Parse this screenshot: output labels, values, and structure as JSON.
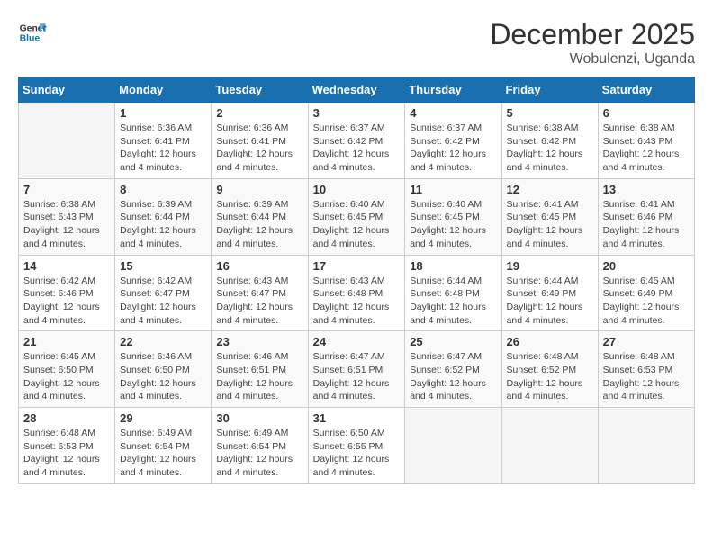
{
  "logo": {
    "line1": "General",
    "line2": "Blue"
  },
  "title": "December 2025",
  "subtitle": "Wobulenzi, Uganda",
  "days_of_week": [
    "Sunday",
    "Monday",
    "Tuesday",
    "Wednesday",
    "Thursday",
    "Friday",
    "Saturday"
  ],
  "weeks": [
    [
      {
        "day": "",
        "info": ""
      },
      {
        "day": "1",
        "info": "Sunrise: 6:36 AM\nSunset: 6:41 PM\nDaylight: 12 hours and 4 minutes."
      },
      {
        "day": "2",
        "info": "Sunrise: 6:36 AM\nSunset: 6:41 PM\nDaylight: 12 hours and 4 minutes."
      },
      {
        "day": "3",
        "info": "Sunrise: 6:37 AM\nSunset: 6:42 PM\nDaylight: 12 hours and 4 minutes."
      },
      {
        "day": "4",
        "info": "Sunrise: 6:37 AM\nSunset: 6:42 PM\nDaylight: 12 hours and 4 minutes."
      },
      {
        "day": "5",
        "info": "Sunrise: 6:38 AM\nSunset: 6:42 PM\nDaylight: 12 hours and 4 minutes."
      },
      {
        "day": "6",
        "info": "Sunrise: 6:38 AM\nSunset: 6:43 PM\nDaylight: 12 hours and 4 minutes."
      }
    ],
    [
      {
        "day": "7",
        "info": "Sunrise: 6:38 AM\nSunset: 6:43 PM\nDaylight: 12 hours and 4 minutes."
      },
      {
        "day": "8",
        "info": "Sunrise: 6:39 AM\nSunset: 6:44 PM\nDaylight: 12 hours and 4 minutes."
      },
      {
        "day": "9",
        "info": "Sunrise: 6:39 AM\nSunset: 6:44 PM\nDaylight: 12 hours and 4 minutes."
      },
      {
        "day": "10",
        "info": "Sunrise: 6:40 AM\nSunset: 6:45 PM\nDaylight: 12 hours and 4 minutes."
      },
      {
        "day": "11",
        "info": "Sunrise: 6:40 AM\nSunset: 6:45 PM\nDaylight: 12 hours and 4 minutes."
      },
      {
        "day": "12",
        "info": "Sunrise: 6:41 AM\nSunset: 6:45 PM\nDaylight: 12 hours and 4 minutes."
      },
      {
        "day": "13",
        "info": "Sunrise: 6:41 AM\nSunset: 6:46 PM\nDaylight: 12 hours and 4 minutes."
      }
    ],
    [
      {
        "day": "14",
        "info": "Sunrise: 6:42 AM\nSunset: 6:46 PM\nDaylight: 12 hours and 4 minutes."
      },
      {
        "day": "15",
        "info": "Sunrise: 6:42 AM\nSunset: 6:47 PM\nDaylight: 12 hours and 4 minutes."
      },
      {
        "day": "16",
        "info": "Sunrise: 6:43 AM\nSunset: 6:47 PM\nDaylight: 12 hours and 4 minutes."
      },
      {
        "day": "17",
        "info": "Sunrise: 6:43 AM\nSunset: 6:48 PM\nDaylight: 12 hours and 4 minutes."
      },
      {
        "day": "18",
        "info": "Sunrise: 6:44 AM\nSunset: 6:48 PM\nDaylight: 12 hours and 4 minutes."
      },
      {
        "day": "19",
        "info": "Sunrise: 6:44 AM\nSunset: 6:49 PM\nDaylight: 12 hours and 4 minutes."
      },
      {
        "day": "20",
        "info": "Sunrise: 6:45 AM\nSunset: 6:49 PM\nDaylight: 12 hours and 4 minutes."
      }
    ],
    [
      {
        "day": "21",
        "info": "Sunrise: 6:45 AM\nSunset: 6:50 PM\nDaylight: 12 hours and 4 minutes."
      },
      {
        "day": "22",
        "info": "Sunrise: 6:46 AM\nSunset: 6:50 PM\nDaylight: 12 hours and 4 minutes."
      },
      {
        "day": "23",
        "info": "Sunrise: 6:46 AM\nSunset: 6:51 PM\nDaylight: 12 hours and 4 minutes."
      },
      {
        "day": "24",
        "info": "Sunrise: 6:47 AM\nSunset: 6:51 PM\nDaylight: 12 hours and 4 minutes."
      },
      {
        "day": "25",
        "info": "Sunrise: 6:47 AM\nSunset: 6:52 PM\nDaylight: 12 hours and 4 minutes."
      },
      {
        "day": "26",
        "info": "Sunrise: 6:48 AM\nSunset: 6:52 PM\nDaylight: 12 hours and 4 minutes."
      },
      {
        "day": "27",
        "info": "Sunrise: 6:48 AM\nSunset: 6:53 PM\nDaylight: 12 hours and 4 minutes."
      }
    ],
    [
      {
        "day": "28",
        "info": "Sunrise: 6:48 AM\nSunset: 6:53 PM\nDaylight: 12 hours and 4 minutes."
      },
      {
        "day": "29",
        "info": "Sunrise: 6:49 AM\nSunset: 6:54 PM\nDaylight: 12 hours and 4 minutes."
      },
      {
        "day": "30",
        "info": "Sunrise: 6:49 AM\nSunset: 6:54 PM\nDaylight: 12 hours and 4 minutes."
      },
      {
        "day": "31",
        "info": "Sunrise: 6:50 AM\nSunset: 6:55 PM\nDaylight: 12 hours and 4 minutes."
      },
      {
        "day": "",
        "info": ""
      },
      {
        "day": "",
        "info": ""
      },
      {
        "day": "",
        "info": ""
      }
    ]
  ]
}
